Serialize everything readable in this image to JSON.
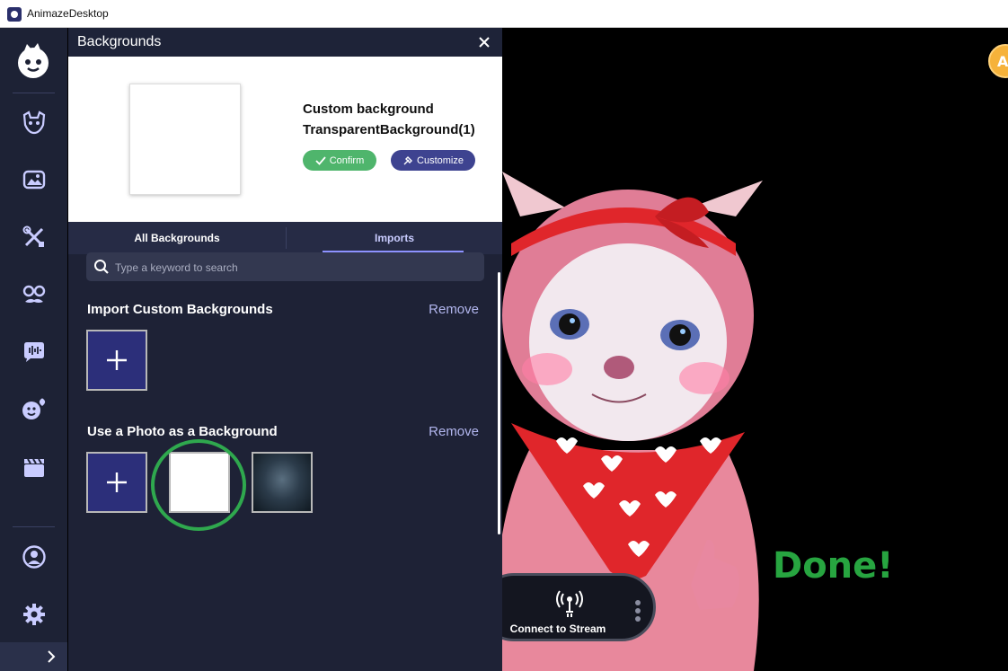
{
  "window": {
    "title": "AnimazeDesktop"
  },
  "sidebar": {
    "items": [
      {
        "name": "avatars",
        "icon": "raccoon-face-icon"
      },
      {
        "name": "backgrounds",
        "icon": "image-icon"
      },
      {
        "name": "props",
        "icon": "wrench-brush-icon"
      },
      {
        "name": "poses",
        "icon": "glasses-mustache-icon"
      },
      {
        "name": "audio",
        "icon": "voice-icon"
      },
      {
        "name": "emotes",
        "icon": "face-heart-icon"
      },
      {
        "name": "scenes",
        "icon": "clapperboard-icon"
      },
      {
        "name": "account",
        "icon": "user-icon"
      },
      {
        "name": "settings",
        "icon": "gear-icon"
      }
    ]
  },
  "panel": {
    "title": "Backgrounds",
    "preview": {
      "type_label": "Custom background",
      "name": "TransparentBackground(1)",
      "confirm_label": "Confirm",
      "customize_label": "Customize"
    },
    "tabs": {
      "all": "All Backgrounds",
      "imports": "Imports",
      "active": "Imports"
    },
    "search": {
      "placeholder": "Type a keyword to search"
    },
    "sections": {
      "import": {
        "title": "Import Custom Backgrounds",
        "remove_label": "Remove"
      },
      "photo": {
        "title": "Use a Photo as a Background",
        "remove_label": "Remove"
      }
    }
  },
  "canvas": {
    "overlay_text": "Done!",
    "stream_label": "Connect to Stream",
    "coin_letter": "A"
  },
  "colors": {
    "accent": "#8d92ff",
    "confirm": "#4fb56c",
    "customize": "#3e4390",
    "done_text": "#27a540",
    "highlight_circle": "#2fa84e"
  }
}
